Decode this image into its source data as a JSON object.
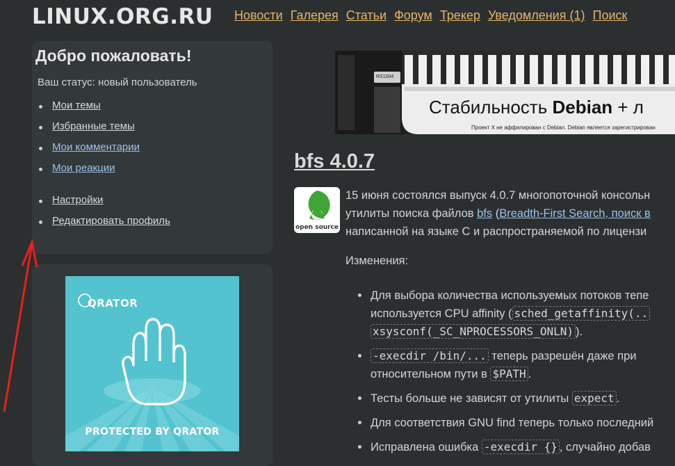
{
  "site": {
    "logo": "LINUX.ORG.RU"
  },
  "nav": [
    {
      "label": "Новости"
    },
    {
      "label": "Галерея"
    },
    {
      "label": "Статьи"
    },
    {
      "label": "Форум"
    },
    {
      "label": "Трекер"
    },
    {
      "label": "Уведомления (1)"
    },
    {
      "label": "Поиск"
    }
  ],
  "welcome": {
    "title": "Добро пожаловать!",
    "status": "Ваш статус: новый пользователь",
    "links": [
      {
        "label": "Мои темы"
      },
      {
        "label": "Избранные темы"
      },
      {
        "label": "Мои комментарии"
      },
      {
        "label": "Мои реакции"
      },
      {
        "label": "Настройки"
      },
      {
        "label": "Редактировать профиль"
      }
    ]
  },
  "ad": {
    "brand": "QRATOR",
    "tagline": "PROTECTED BY QRATOR"
  },
  "banner": {
    "text_prefix": "Стабильность ",
    "text_bold": "Debian",
    "text_suffix": " + л",
    "tag": "RS1004",
    "small": "Проект X не аффилирован с Debian. Debian является зарегистрирован"
  },
  "article": {
    "title": "bfs 4.0.7",
    "logo_label": "open source",
    "intro_line1": "15 июня состоялся выпуск 4.0.7 многопоточной консольн",
    "intro_line2_a": "утилиты поиска файлов ",
    "intro_link1": "bfs",
    "intro_line2_b": " (",
    "intro_link2": "Breadth-First Search, поиск в",
    "intro_line3": "написанной на языке C и распространяемой по лицензи",
    "changes_label": "Изменения:",
    "items": [
      {
        "l1": "Для выбора количества используемых потоков тепе",
        "l2a": "используется CPU affinity (",
        "code1": "sched_getaffinity(..",
        "code2": "xsysconf(_SC_NPROCESSORS_ONLN)",
        "l3b": ")."
      },
      {
        "code1": "-execdir /bin/...",
        "l1b": " теперь разрешён даже при",
        "l2a": "относительном пути в ",
        "code2": "$PATH",
        "l2b": "."
      },
      {
        "l1a": "Тесты больше не зависят от утилиты ",
        "code1": "expect",
        "l1b": "."
      },
      {
        "l1": "Для соответствия GNU find теперь только последний"
      },
      {
        "l1a": "Исправлена ошибка ",
        "code1": "-execdir {}",
        "l1b": ", случайно добав"
      }
    ]
  },
  "colors": {
    "background": "#2b2f30",
    "panel": "#33383a",
    "nav_link": "#e5b56a",
    "link_blue": "#9fc2e8",
    "qrator_teal": "#53c3cf",
    "arrow": "#e8201a"
  }
}
